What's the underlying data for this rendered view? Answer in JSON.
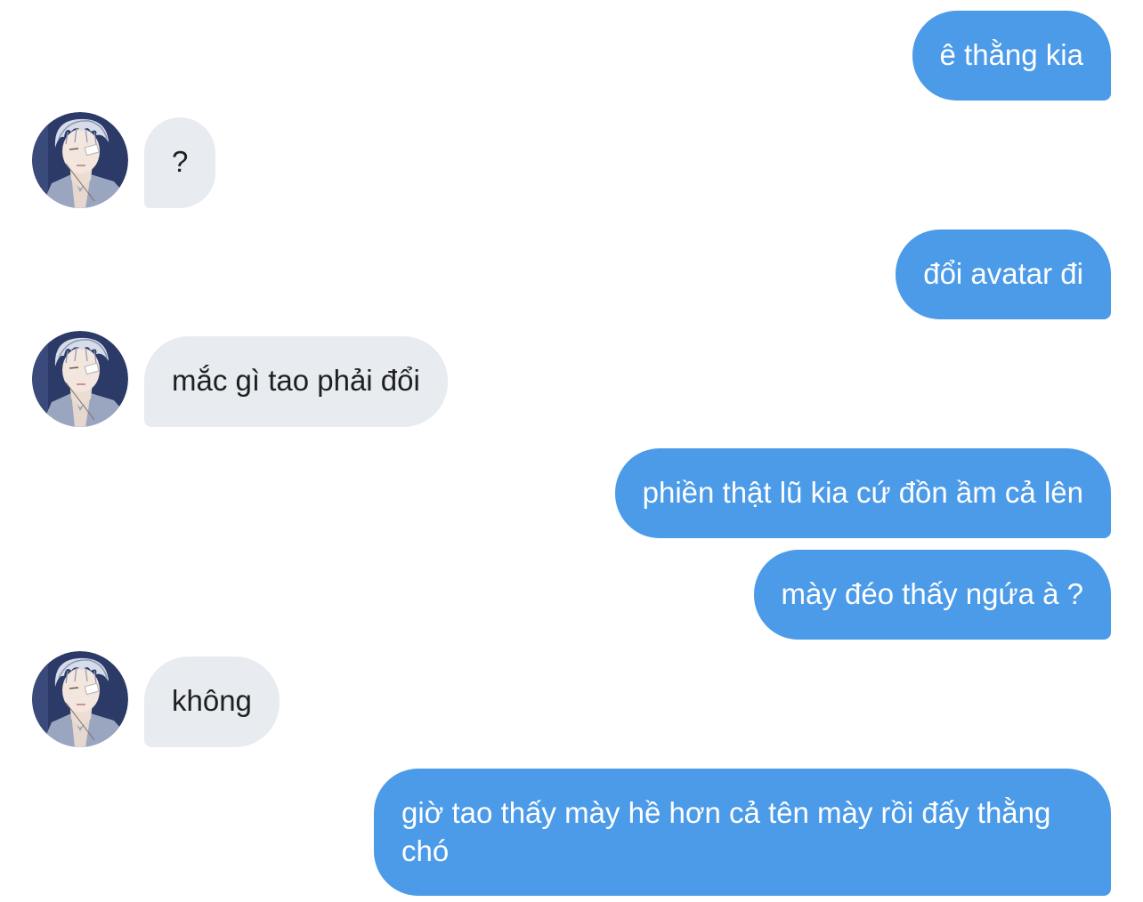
{
  "conversation": {
    "messages": [
      {
        "from": "me",
        "text": "ê thằng kia"
      },
      {
        "from": "them",
        "text": "?"
      },
      {
        "from": "me",
        "text": "đổi avatar đi"
      },
      {
        "from": "them",
        "text": "mắc gì tao phải đổi"
      },
      {
        "from": "me",
        "text": "phiền thật lũ kia cứ đồn ầm cả lên"
      },
      {
        "from": "me",
        "text": "mày đéo thấy ngứa à ?"
      },
      {
        "from": "them",
        "text": "không"
      },
      {
        "from": "me",
        "text": "giờ tao thấy mày hề hơn cả tên mày rồi đấy thằng chó"
      }
    ]
  },
  "theme": {
    "sent_bubble_color": "#4c9be8",
    "received_bubble_color": "#e8ebef",
    "sent_text_color": "#ffffff",
    "received_text_color": "#1d1f21",
    "background": "#ffffff"
  },
  "avatar": {
    "icon": "anime-boy-white-hair-avatar-icon"
  }
}
